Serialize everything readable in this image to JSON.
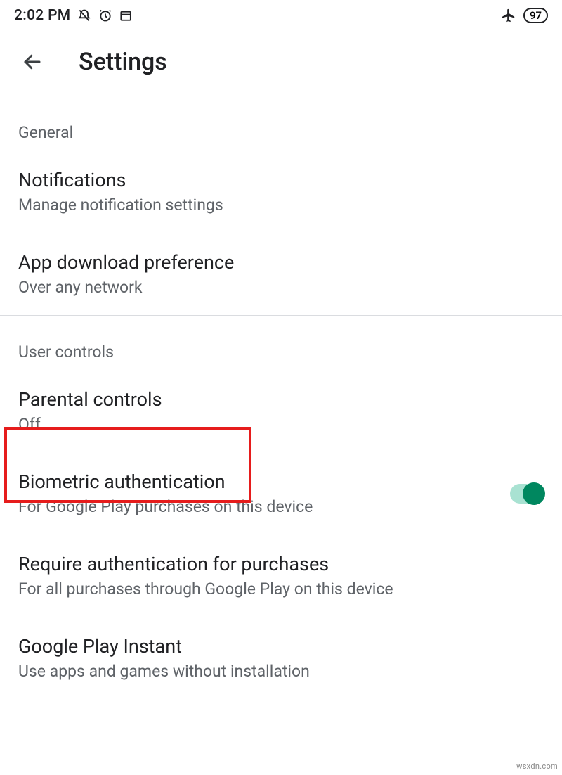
{
  "status_bar": {
    "time": "2:02 PM",
    "battery": "97"
  },
  "header": {
    "title": "Settings"
  },
  "sections": {
    "general": {
      "label": "General",
      "items": [
        {
          "title": "Notifications",
          "subtitle": "Manage notification settings"
        },
        {
          "title": "App download preference",
          "subtitle": "Over any network"
        }
      ]
    },
    "user_controls": {
      "label": "User controls",
      "items": [
        {
          "title": "Parental controls",
          "subtitle": "Off"
        },
        {
          "title": "Biometric authentication",
          "subtitle": "For Google Play purchases on this device",
          "toggle": true
        },
        {
          "title": "Require authentication for purchases",
          "subtitle": "For all purchases through Google Play on this device"
        },
        {
          "title": "Google Play Instant",
          "subtitle": "Use apps and games without installation"
        }
      ]
    }
  },
  "watermark": "wsxdn.com"
}
